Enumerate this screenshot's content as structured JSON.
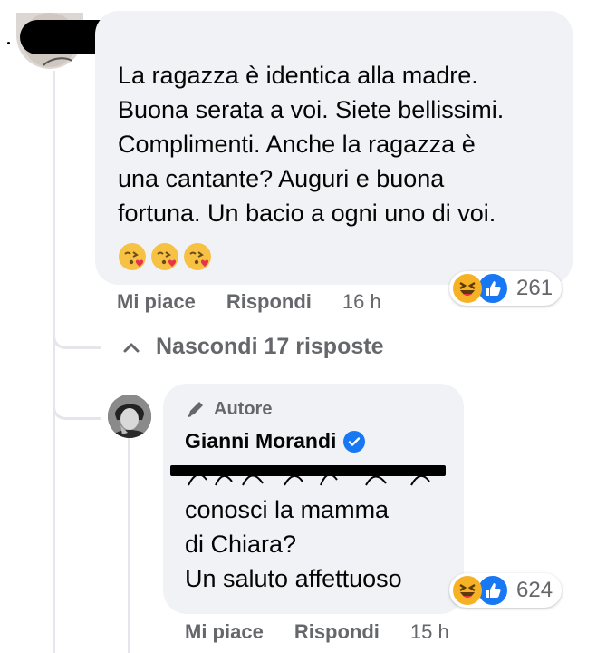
{
  "comment": {
    "text_lines": [
      "La ragazza è identica alla madre.",
      "Buona serata a voi. Siete bellissimi.",
      "Complimenti. Anche la ragazza è",
      "una cantante? Auguri e buona",
      "fortuna. Un bacio a ogni uno di voi."
    ],
    "emoji_icon": "kissing-heart-emoji",
    "reaction_count": "261",
    "like_label": "Mi piace",
    "reply_label": "Rispondi",
    "time": "16 h"
  },
  "replies_toggle": {
    "label": "Nascondi 17 risposte",
    "icon": "chevron-up-icon"
  },
  "reply": {
    "badge_label": "Autore",
    "badge_icon": "pen-icon",
    "author": "Gianni Morandi",
    "verified": true,
    "text_lines": [
      "conosci la mamma",
      "di Chiara?",
      "Un saluto affettuoso"
    ],
    "reaction_count": "624",
    "like_label": "Mi piace",
    "reply_label": "Rispondi",
    "time": "15 h"
  },
  "colors": {
    "bubble": "#f0f2f5",
    "secondary_text": "#65676b",
    "like_blue": "#1877f2",
    "haha_yellow": "#f7b125"
  }
}
